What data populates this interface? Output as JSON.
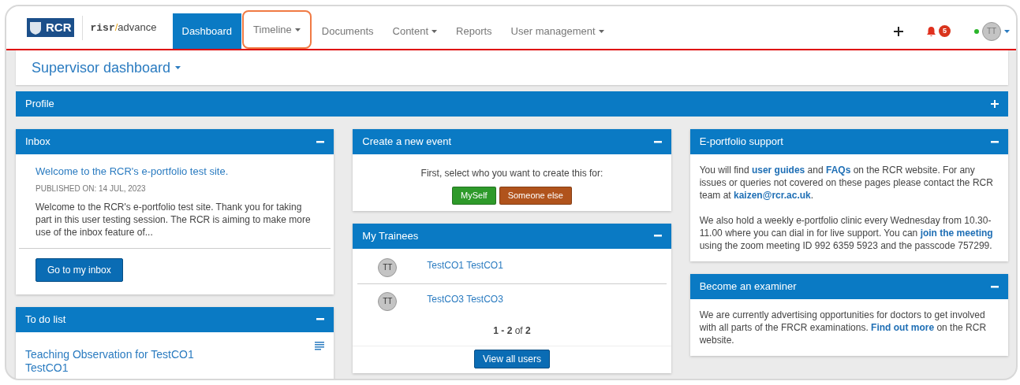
{
  "brand": {
    "crest": "RCR",
    "prefix": "risr",
    "separator": "/",
    "suffix": "advance"
  },
  "nav": [
    {
      "label": "Dashboard",
      "selected": true,
      "dropdown": false,
      "highlighted": false
    },
    {
      "label": "Timeline",
      "selected": false,
      "dropdown": true,
      "highlighted": true
    },
    {
      "label": "Documents",
      "selected": false,
      "dropdown": false,
      "highlighted": false
    },
    {
      "label": "Content",
      "selected": false,
      "dropdown": true,
      "highlighted": false
    },
    {
      "label": "Reports",
      "selected": false,
      "dropdown": false,
      "highlighted": false
    },
    {
      "label": "User management",
      "selected": false,
      "dropdown": true,
      "highlighted": false
    }
  ],
  "notifications": {
    "count": "5"
  },
  "user": {
    "initials": "TT",
    "online": true
  },
  "page_header": {
    "title": "Supervisor dashboard"
  },
  "profile": {
    "title": "Profile",
    "expanded": false
  },
  "columns": [
    [
      {
        "kind": "inbox",
        "title": "Inbox",
        "expanded": true,
        "message": {
          "title": "Welcome to the RCR's e-portfolio test site.",
          "published": "PUBLISHED ON: 14 JUL, 2023",
          "excerpt": "Welcome to the RCR's e-portfolio test site. Thank you for taking part in this user testing session. The RCR is aiming to make more use of the inbox feature of..."
        },
        "button": "Go to my inbox"
      },
      {
        "kind": "todo",
        "title": "To do list",
        "expanded": true,
        "items": [
          {
            "title": "Teaching Observation for TestCO1 TestCO1"
          }
        ]
      }
    ],
    [
      {
        "kind": "create_event",
        "title": "Create a new event",
        "expanded": true,
        "prompt": "First, select who you want to create this for:",
        "options": [
          {
            "label": "MySelf",
            "color": "#2e9a2a"
          },
          {
            "label": "Someone else",
            "color": "#b0531c"
          }
        ]
      },
      {
        "kind": "trainees",
        "title": "My Trainees",
        "expanded": true,
        "items": [
          {
            "initials": "TT",
            "name": "TestCO1 TestCO1"
          },
          {
            "initials": "TT",
            "name": "TestCO3 TestCO3"
          }
        ],
        "pagination": "**1 - 2** of **2**",
        "button": "View all users"
      }
    ],
    [
      {
        "kind": "text",
        "title": "E-portfolio support",
        "expanded": true,
        "paragraphs": [
          [
            {
              "text": "You will find ",
              "link": false
            },
            {
              "text": "user guides",
              "link": true
            },
            {
              "text": " and ",
              "link": false
            },
            {
              "text": "FAQs",
              "link": true
            },
            {
              "text": " on the RCR website. For any issues or queries not covered on these pages please contact the RCR team at ",
              "link": false
            },
            {
              "text": "kaizen@rcr.ac.uk",
              "link": true
            },
            {
              "text": ".",
              "link": false
            }
          ],
          [
            {
              "text": "We also hold a weekly e-portfolio clinic every Wednesday from 10.30-11.00 where you can dial in for live support. You can ",
              "link": false
            },
            {
              "text": "join the meeting",
              "link": true
            },
            {
              "text": " using the zoom meeting ID 992 6359 5923 and the passcode 757299.",
              "link": false
            }
          ]
        ]
      },
      {
        "kind": "text",
        "title": "Become an examiner",
        "expanded": true,
        "paragraphs": [
          [
            {
              "text": "We are currently advertising opportunities for doctors to get involved with all parts of the FRCR examinations. ",
              "link": false
            },
            {
              "text": "Find out more",
              "link": true
            },
            {
              "text": " on the RCR website.",
              "link": false
            }
          ]
        ]
      }
    ]
  ]
}
